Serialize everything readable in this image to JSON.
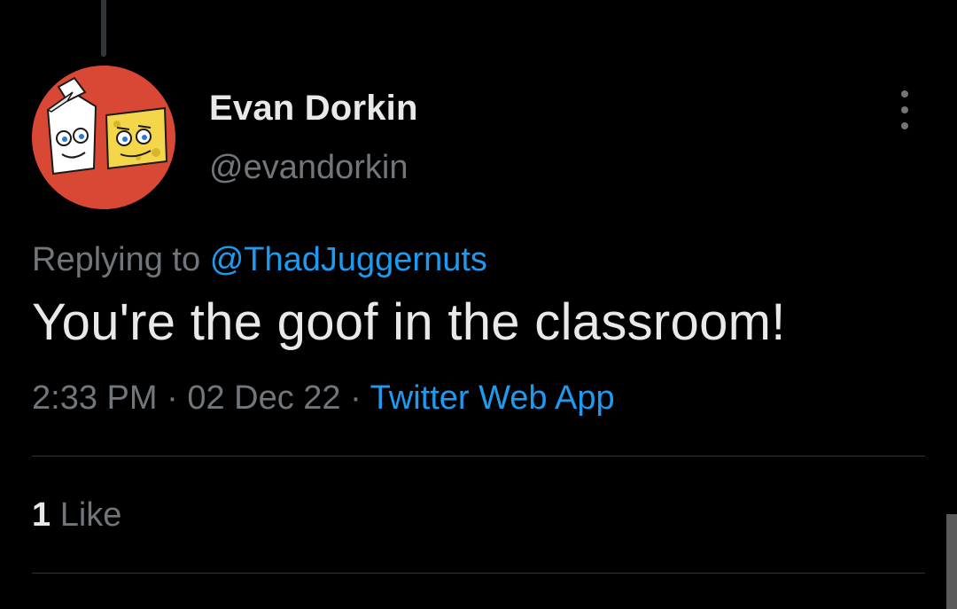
{
  "tweet": {
    "author": {
      "display_name": "Evan Dorkin",
      "handle": "@evandorkin",
      "avatar_icon": "milk-and-cheese-avatar"
    },
    "replying_to": {
      "prefix": "Replying to",
      "mention": "@ThadJuggernuts"
    },
    "text": "You're the goof in the classroom!",
    "time": "2:33 PM",
    "date": "02 Dec 22",
    "separator": "·",
    "source": "Twitter Web App",
    "likes": {
      "count": "1",
      "label": "Like"
    },
    "more_icon": "more-vertical-icon"
  },
  "colors": {
    "background": "#000000",
    "primary_text": "#e7e9ea",
    "secondary_text": "#71767b",
    "accent": "#1d9bf0",
    "divider": "#2f3336",
    "avatar_bg": "#d94834"
  }
}
